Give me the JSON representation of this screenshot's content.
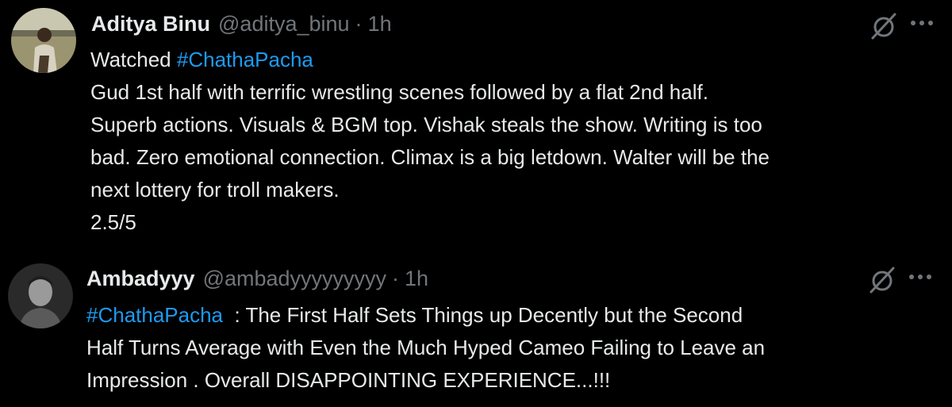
{
  "tweets": [
    {
      "display_name": "Aditya Binu",
      "handle": "@aditya_binu",
      "separator": "·",
      "time": "1h",
      "avatar_icon": "person-photo-avatar",
      "grok_icon": "slashed-circle-icon",
      "more_icon": "ellipsis-icon",
      "line1_prefix": "Watched ",
      "hashtag": "#ChathaPacha",
      "lines": [
        "Gud 1st half with terrific wrestling scenes followed by a flat 2nd half.",
        "Superb actions. Visuals & BGM top. Vishak steals the show. Writing is too",
        "bad. Zero emotional connection. Climax is a big letdown. Walter will be the",
        "next lottery for troll makers.",
        "2.5/5"
      ]
    },
    {
      "display_name": "Ambadyyy",
      "handle": "@ambadyyyyyyyyy",
      "separator": "·",
      "time": "1h",
      "avatar_icon": "person-photo-avatar",
      "grok_icon": "slashed-circle-icon",
      "more_icon": "ellipsis-icon",
      "hashtag": "#ChathaPacha",
      "line1_suffix": "  : The First Half Sets Things up Decently but the Second",
      "lines": [
        "Half Turns Average with Even the Much Hyped Cameo Failing to Leave an",
        "Impression . Overall DISAPPOINTING EXPERIENCE...!!!"
      ]
    }
  ],
  "colors": {
    "background": "#000000",
    "text": "#e7e9ea",
    "secondary": "#71767b",
    "link": "#1d9bf0"
  }
}
